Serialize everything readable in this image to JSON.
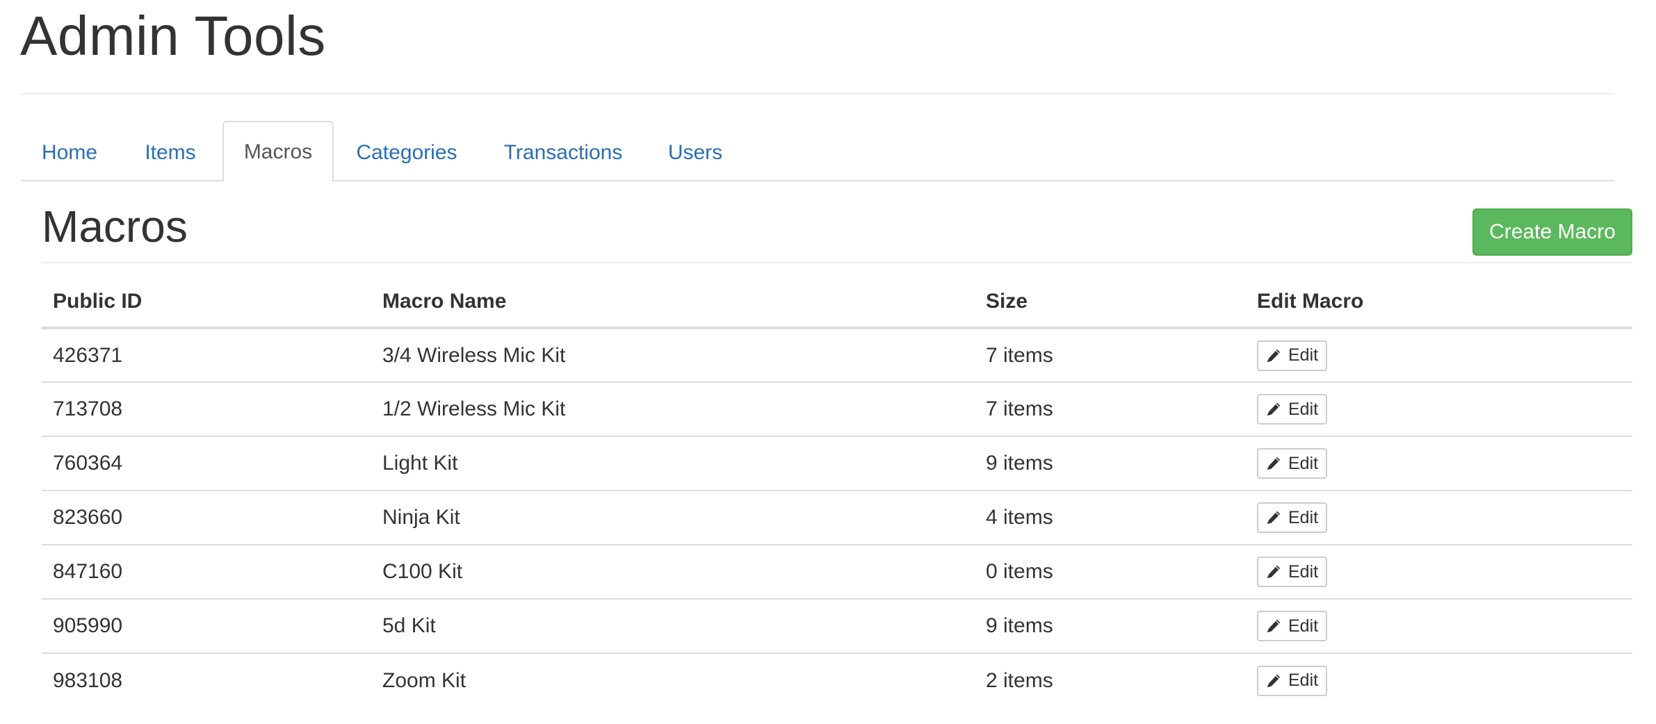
{
  "header": {
    "title": "Admin Tools"
  },
  "tabs": [
    {
      "label": "Home"
    },
    {
      "label": "Items"
    },
    {
      "label": "Macros"
    },
    {
      "label": "Categories"
    },
    {
      "label": "Transactions"
    },
    {
      "label": "Users"
    }
  ],
  "active_tab": "Macros",
  "section": {
    "title": "Macros",
    "create_button_label": "Create Macro"
  },
  "table": {
    "columns": [
      "Public ID",
      "Macro Name",
      "Size",
      "Edit Macro"
    ],
    "rows": [
      {
        "public_id": "426371",
        "name": "3/4 Wireless Mic Kit",
        "size": "7 items",
        "edit_label": "Edit"
      },
      {
        "public_id": "713708",
        "name": "1/2 Wireless Mic Kit",
        "size": "7 items",
        "edit_label": "Edit"
      },
      {
        "public_id": "760364",
        "name": "Light Kit",
        "size": "9 items",
        "edit_label": "Edit"
      },
      {
        "public_id": "823660",
        "name": "Ninja Kit",
        "size": "4 items",
        "edit_label": "Edit"
      },
      {
        "public_id": "847160",
        "name": "C100 Kit",
        "size": "0 items",
        "edit_label": "Edit"
      },
      {
        "public_id": "905990",
        "name": "5d Kit",
        "size": "9 items",
        "edit_label": "Edit"
      },
      {
        "public_id": "983108",
        "name": "Zoom Kit",
        "size": "2 items",
        "edit_label": "Edit"
      }
    ]
  },
  "icons": {
    "edit": "pencil-icon"
  },
  "colors": {
    "link": "#2a6fb2",
    "create_button": "#5cb85c",
    "text": "#333333",
    "border": "#dddddd"
  }
}
